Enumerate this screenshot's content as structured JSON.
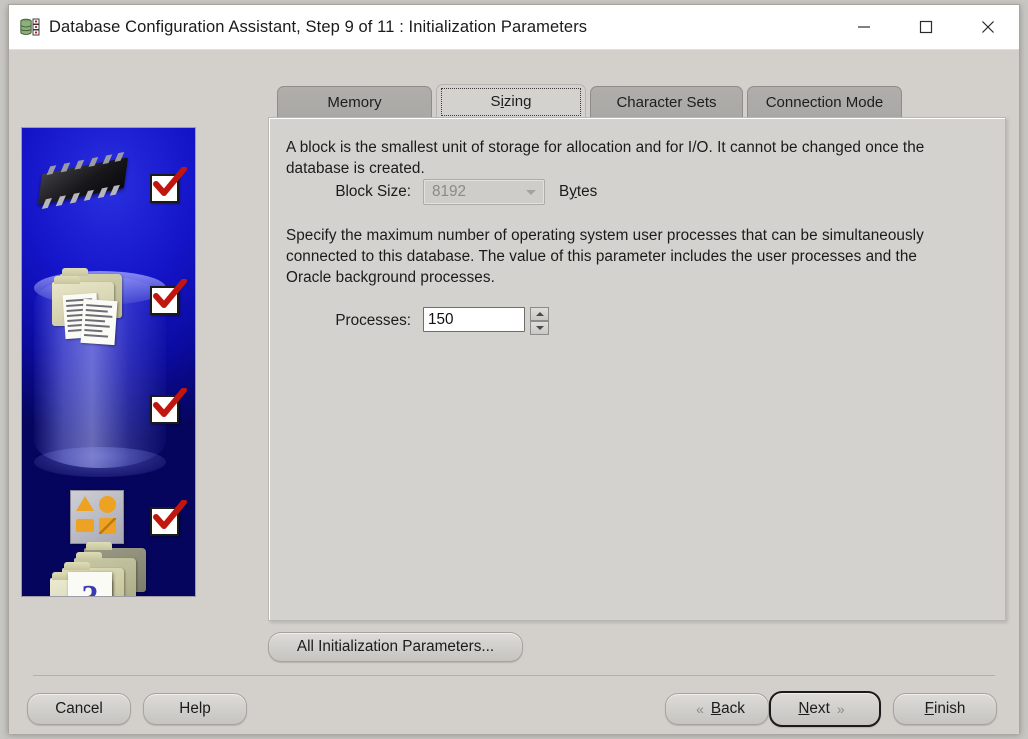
{
  "window": {
    "title": "Database Configuration Assistant, Step 9 of 11 : Initialization Parameters",
    "icon": "database-server-icon",
    "controls": {
      "minimize": "minimize-icon",
      "maximize": "maximize-icon",
      "close": "close-icon"
    }
  },
  "sidebar": {
    "image_alt": "oracle-database-wizard-graphic",
    "checkmarks": 4,
    "accent_blue": "#0b0ba8",
    "check_red": "#c0160f"
  },
  "tabs": [
    {
      "label": "Memory",
      "mnemonic": "M",
      "selected": false
    },
    {
      "label": "Sizing",
      "mnemonic": "i",
      "selected": true
    },
    {
      "label": "Character Sets",
      "mnemonic": "",
      "selected": false
    },
    {
      "label": "Connection Mode",
      "mnemonic": "",
      "selected": false
    }
  ],
  "panel": {
    "block_paragraph": "A block is the smallest unit of storage for allocation and for I/O. It cannot be changed once the database is created.",
    "block_size": {
      "label": "Block Size:",
      "value": "8192",
      "enabled": false,
      "unit_prefix": "B",
      "unit_mnemonic": "y",
      "unit_suffix": "tes"
    },
    "processes_paragraph": "Specify the maximum number of operating system user processes that can be simultaneously connected to this database. The value of this parameter includes the user processes and the Oracle background processes.",
    "processes": {
      "label": "Processes:",
      "value": "150",
      "spinner_up": "spinner-up-icon",
      "spinner_down": "spinner-down-icon"
    }
  },
  "all_params_button": "All Initialization Parameters...",
  "footer": {
    "cancel": "Cancel",
    "help": "Help",
    "back": {
      "prefix": "B",
      "mnemonic_rest": "ack",
      "chevron": "«"
    },
    "next": {
      "prefix": "N",
      "mnemonic_rest": "ext",
      "chevron": "»"
    },
    "finish": {
      "prefix": "F",
      "mnemonic_rest": "inish"
    }
  }
}
